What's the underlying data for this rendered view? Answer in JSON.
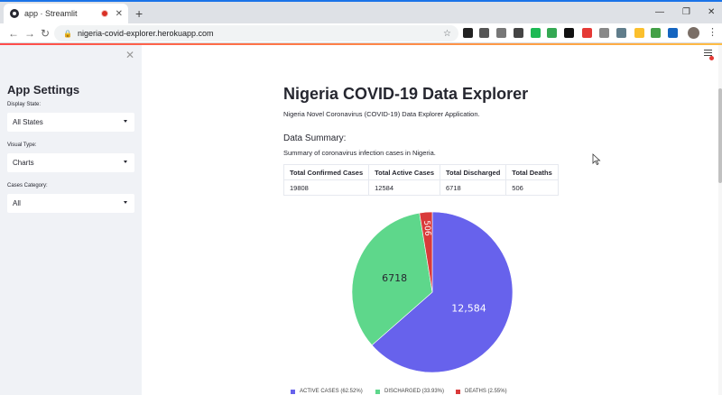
{
  "browser": {
    "tab_title": "app · Streamlit",
    "tab_close": "✕",
    "new_tab": "+",
    "url": "nigeria-covid-explorer.herokuapp.com",
    "window_controls": [
      "—",
      "❐",
      "✕"
    ],
    "icons": [
      "back-icon",
      "forward-icon",
      "reload-icon",
      "lock-icon",
      "star-icon",
      "profile-icon",
      "menu-icon"
    ],
    "extension_colors": [
      "#222222",
      "#555555",
      "#777777",
      "#444444",
      "#1db954",
      "#34a853",
      "#111111",
      "#e53935",
      "#888888",
      "#607d8b",
      "#fbc02d",
      "#43a047",
      "#1565c0",
      "#e53935",
      "#9e9e9e",
      "#1976d2",
      "#666666"
    ]
  },
  "sidebar": {
    "close_label": "✕",
    "title": "App Settings",
    "display_state": {
      "label": "Display State:",
      "value": "All States"
    },
    "visual_type": {
      "label": "Visual Type:",
      "value": "Charts"
    },
    "cases_category": {
      "label": "Cases Category:",
      "value": "All"
    }
  },
  "main": {
    "title": "Nigeria COVID-19 Data Explorer",
    "subtitle": "Nigeria Novel Coronavirus (COVID-19) Data Explorer Application.",
    "summary_heading": "Data Summary:",
    "summary_text": "Summary of coronavirus infection cases in Nigeria.",
    "table": {
      "headers": [
        "Total Confirmed Cases",
        "Total Active Cases",
        "Total Discharged",
        "Total Deaths"
      ],
      "row": [
        "19808",
        "12584",
        "6718",
        "506"
      ]
    }
  },
  "colors": {
    "active": "#6762ec",
    "discharged": "#5ed78b",
    "deaths": "#d93a3a",
    "accent_start": "#ff4b4b",
    "accent_end": "#ffbd45"
  },
  "chart_data": {
    "type": "pie",
    "slices": [
      {
        "name": "ACTIVE CASES (62.52%)",
        "value": 12584,
        "label": "12,584",
        "color": "#6762ec"
      },
      {
        "name": "DISCHARGED (33.93%)",
        "value": 6718,
        "label": "6718",
        "color": "#5ed78b"
      },
      {
        "name": "DEATHS (2.55%)",
        "value": 506,
        "label": "506",
        "color": "#d93a3a"
      }
    ],
    "start_angle_deg": 0,
    "direction": "clockwise",
    "legend_position": "bottom"
  }
}
